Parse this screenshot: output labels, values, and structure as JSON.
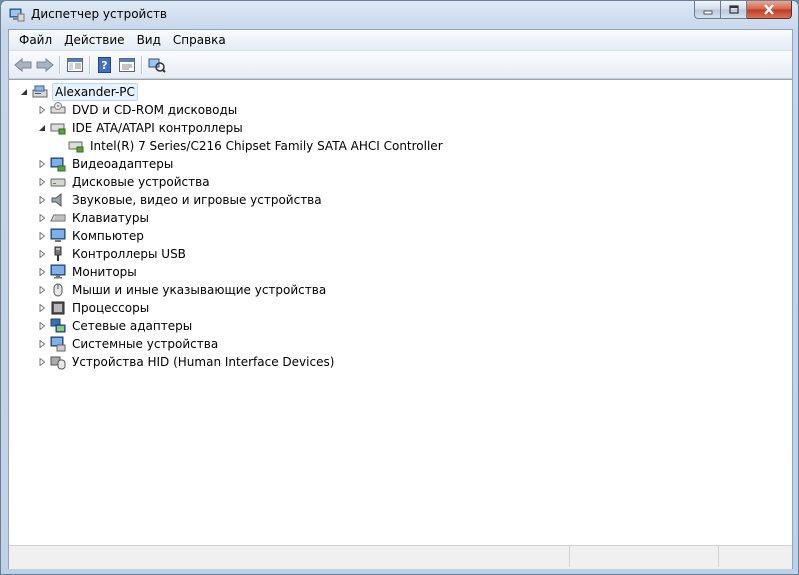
{
  "window": {
    "title": "Диспетчер устройств"
  },
  "menu": [
    "Файл",
    "Действие",
    "Вид",
    "Справка"
  ],
  "toolbar": {
    "buttons": [
      {
        "icon": "back-arrow-icon"
      },
      {
        "icon": "forward-arrow-icon"
      },
      {
        "icon": "show-hide-console-tree-icon"
      },
      {
        "icon": "help-icon"
      },
      {
        "icon": "properties-icon"
      },
      {
        "icon": "scan-hardware-changes-icon"
      }
    ]
  },
  "tree": {
    "root": "Alexander-PC",
    "items": [
      {
        "label": "DVD и CD-ROM дисководы",
        "icon": "dvd-drive-icon",
        "expanded": false
      },
      {
        "label": "IDE ATA/ATAPI контроллеры",
        "icon": "ide-controller-icon",
        "expanded": true,
        "children": [
          {
            "label": "Intel(R) 7 Series/C216 Chipset Family SATA AHCI Controller",
            "icon": "ide-controller-icon"
          }
        ]
      },
      {
        "label": "Видеоадаптеры",
        "icon": "display-adapter-icon",
        "expanded": false
      },
      {
        "label": "Дисковые устройства",
        "icon": "disk-drive-icon",
        "expanded": false
      },
      {
        "label": "Звуковые, видео и игровые устройства",
        "icon": "speaker-icon",
        "expanded": false
      },
      {
        "label": "Клавиатуры",
        "icon": "keyboard-icon",
        "expanded": false
      },
      {
        "label": "Компьютер",
        "icon": "computer-icon",
        "expanded": false
      },
      {
        "label": "Контроллеры USB",
        "icon": "usb-icon",
        "expanded": false
      },
      {
        "label": "Мониторы",
        "icon": "monitor-icon",
        "expanded": false
      },
      {
        "label": "Мыши и иные указывающие устройства",
        "icon": "mouse-icon",
        "expanded": false
      },
      {
        "label": "Процессоры",
        "icon": "processor-icon",
        "expanded": false
      },
      {
        "label": "Сетевые адаптеры",
        "icon": "network-adapter-icon",
        "expanded": false
      },
      {
        "label": "Системные устройства",
        "icon": "system-device-icon",
        "expanded": false
      },
      {
        "label": "Устройства HID (Human Interface Devices)",
        "icon": "hid-icon",
        "expanded": false
      }
    ]
  }
}
